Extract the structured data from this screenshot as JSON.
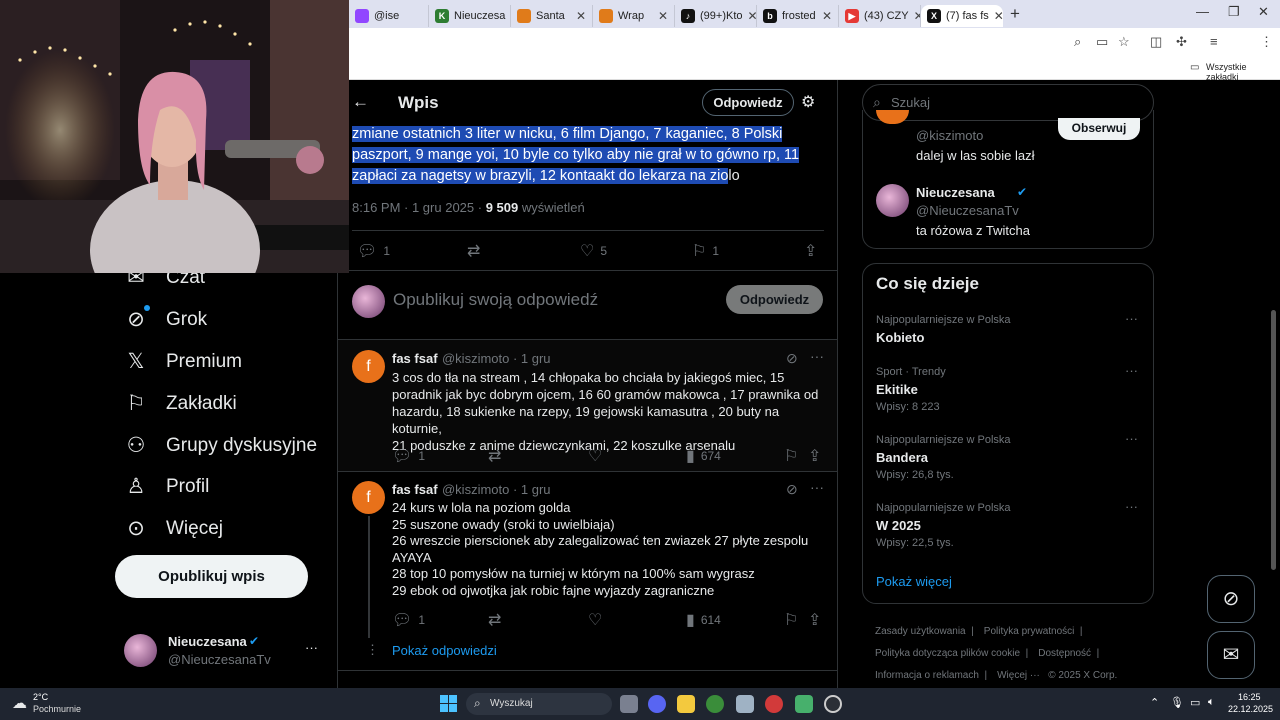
{
  "browser": {
    "tabs": [
      {
        "label": "@ise",
        "color": "#9146ff"
      },
      {
        "label": "Nieuczesa",
        "color": "#2e7d32"
      },
      {
        "label": "Santa",
        "color": "#e07b1a"
      },
      {
        "label": "Wrap",
        "color": "#e07b1a"
      },
      {
        "label": "(99+)Kto",
        "color": "#111111"
      },
      {
        "label": "frosted",
        "color": "#111111"
      },
      {
        "label": "(43) CZY",
        "color": "#e53935"
      },
      {
        "label": "(7) fas fs",
        "color": "#111111"
      }
    ],
    "bookmarks_label": "Wszystkie zakładki"
  },
  "sidebar": {
    "items": [
      {
        "label": "Czat",
        "icon": "chat-icon"
      },
      {
        "label": "Grok",
        "icon": "grok-icon"
      },
      {
        "label": "Premium",
        "icon": "x-logo-icon"
      },
      {
        "label": "Zakładki",
        "icon": "bookmark-icon"
      },
      {
        "label": "Grupy dyskusyjne",
        "icon": "groups-icon"
      },
      {
        "label": "Profil",
        "icon": "profile-icon"
      },
      {
        "label": "Więcej",
        "icon": "more-circle-icon"
      }
    ],
    "post_button": "Opublikuj wpis",
    "account": {
      "name": "Nieuczesana",
      "handle": "@NieuczesanaTv",
      "more": "···"
    }
  },
  "header": {
    "title": "Wpis",
    "reply_button": "Odpowiedz"
  },
  "post": {
    "text_line1": "zmiane ostatnich 3 liter w nicku, 6 film Django, 7 kaganiec, 8 Polski",
    "text_line2": "paszport, 9 mange yoi, 10 byle co tylko aby nie grał w to gówno rp, 11",
    "text_line3a": "zapłaci za nagetsy w brazyli, 12 kontaakt do lekarza na zio",
    "text_line3b": "lo",
    "time": "8:16 PM · 1 gru 2025 ·",
    "views_count": "9 509",
    "views_label": "wyświetleń",
    "replies": "1",
    "likes": "5",
    "bookmarks": "1"
  },
  "composer": {
    "placeholder": "Opublikuj swoją odpowiedź",
    "button": "Odpowiedz"
  },
  "replies": [
    {
      "name": "fas fsaf",
      "meta": "@kiszimoto · 1 gru",
      "avatar": "f",
      "lines": [
        "3 cos do tła na stream , 14 chłopaka bo chciała by jakiegoś miec, 15",
        "poradnik jak byc dobrym ojcem, 16  60 gramów makowca , 17 prawnika od",
        "hazardu, 18 sukienke na rzepy, 19 gejowski kamasutra , 20 buty na koturnie,",
        "21 poduszke z anime dziewczynkami, 22 koszulke arsenalu"
      ],
      "replies": "1",
      "views": "674"
    },
    {
      "name": "fas fsaf",
      "meta": "@kiszimoto · 1 gru",
      "avatar": "f",
      "lines": [
        "24  kurs w lola na poziom golda",
        "25 suszone owady (sroki to uwielbiaja)",
        "26 wreszcie pierscionek aby zalegalizować ten zwiazek 27 płyte zespolu",
        "AYAYA",
        "28 top 10 pomysłów na turniej w którym na 100% sam wygrasz",
        "29 ebok od ojwotjka jak robic fajne wyjazdy zagraniczne"
      ],
      "replies": "1",
      "views": "614"
    }
  ],
  "show_replies": "Pokaż odpowiedzi",
  "search": {
    "placeholder": "Szukaj"
  },
  "who_to_follow": [
    {
      "handle": "@kiszimoto",
      "bio": "dalej w las sobie lazł",
      "button": "Obserwuj"
    },
    {
      "name": "Nieuczesana",
      "handle": "@NieuczesanaTv",
      "bio": "ta różowa z Twitcha"
    }
  ],
  "trends": {
    "title": "Co się dzieje",
    "items": [
      {
        "meta": "Najpopularniejsze w Polska",
        "name": "Kobieto",
        "posts": ""
      },
      {
        "meta": "Sport · Trendy",
        "name": "Ekitike",
        "posts": "Wpisy: 8 223"
      },
      {
        "meta": "Najpopularniejsze w Polska",
        "name": "Bandera",
        "posts": "Wpisy: 26,8 tys."
      },
      {
        "meta": "Najpopularniejsze w Polska",
        "name": "W 2025",
        "posts": "Wpisy: 22,5 tys."
      }
    ],
    "show_more": "Pokaż więcej"
  },
  "footer": {
    "links": [
      "Zasady użytkowania",
      "Polityka prywatności",
      "Polityka dotycząca plików cookie",
      "Dostępność",
      "Informacja o reklamach",
      "Więcej ···",
      "© 2025 X Corp."
    ]
  },
  "taskbar": {
    "weather_temp": "2°C",
    "weather_desc": "Pochmurnie",
    "search": "Wyszukaj",
    "time": "16:25",
    "date": "22.12.2025"
  },
  "colors": {
    "accent": "#1d9bf0",
    "selection": "#1e4bb3",
    "avatar_orange": "#e8711a"
  }
}
